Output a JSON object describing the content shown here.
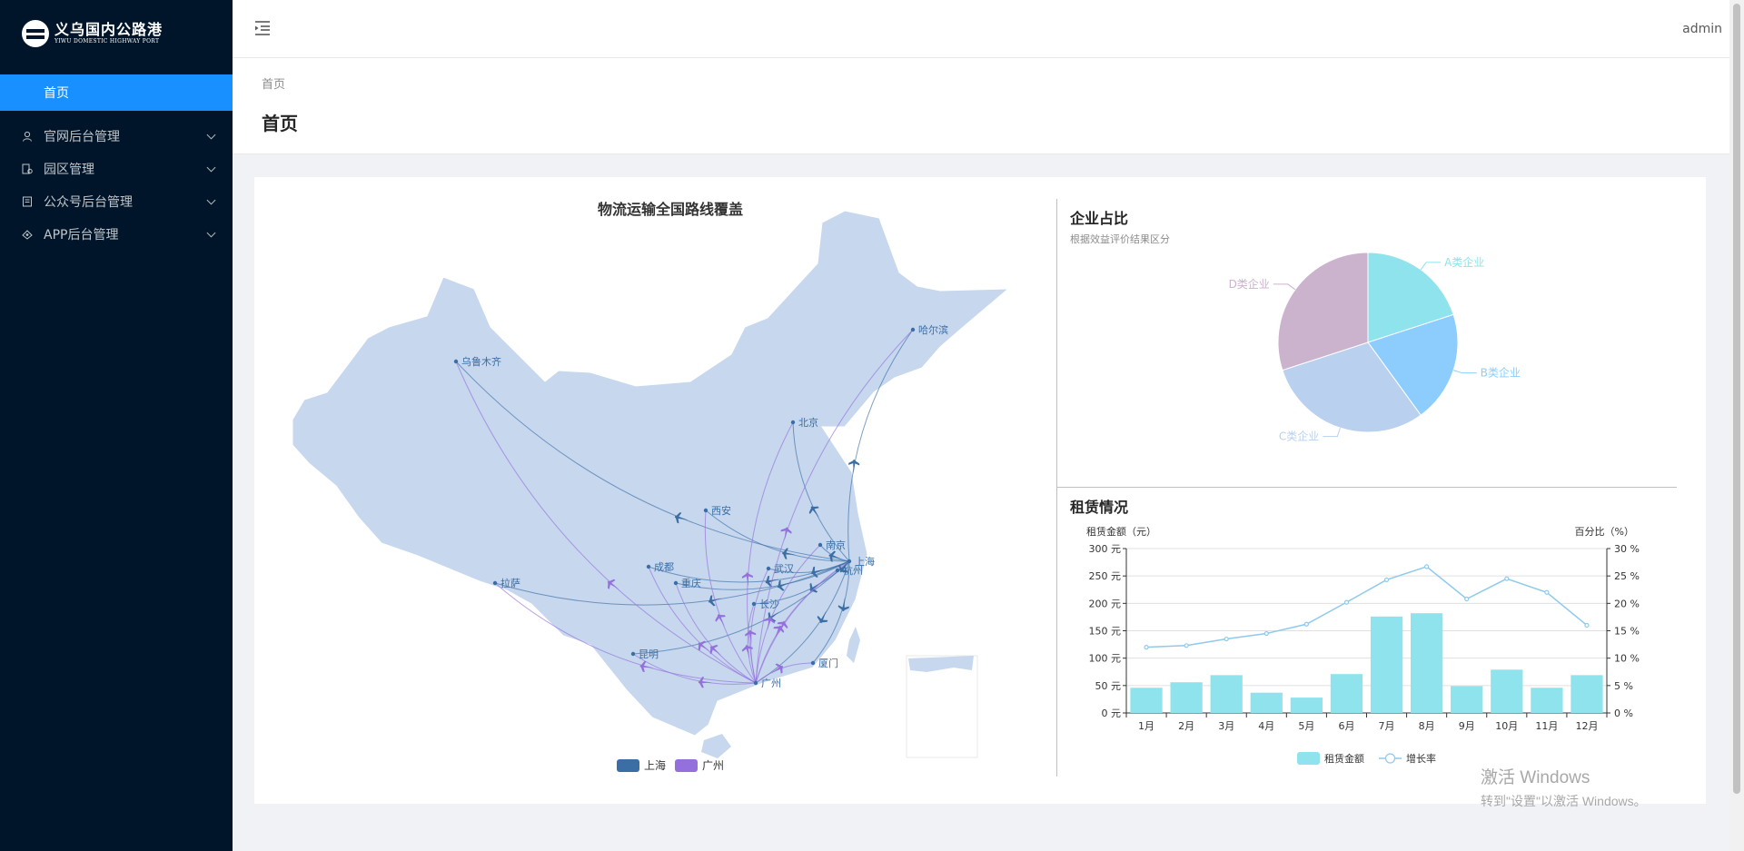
{
  "app": {
    "logo_cn": "义乌国内公路港",
    "logo_en": "YIWU DOMESTIC HIGHWAY PORT"
  },
  "sidebar": {
    "items": [
      {
        "label": "首页",
        "icon": "home-icon"
      },
      {
        "label": "官网后台管理",
        "icon": "user-icon"
      },
      {
        "label": "园区管理",
        "icon": "park-icon"
      },
      {
        "label": "公众号后台管理",
        "icon": "article-icon"
      },
      {
        "label": "APP后台管理",
        "icon": "app-icon"
      }
    ]
  },
  "header": {
    "user": "admin"
  },
  "breadcrumb": "首页",
  "page_title": "首页",
  "map": {
    "title": "物流运输全国路线覆盖",
    "cities": [
      "乌鲁木齐",
      "哈尔滨",
      "北京",
      "西安",
      "南京",
      "上海",
      "杭州",
      "成都",
      "武汉",
      "重庆",
      "长沙",
      "拉萨",
      "昆明",
      "厦门",
      "广州"
    ],
    "legend": [
      {
        "name": "上海",
        "color": "#3a6ea5"
      },
      {
        "name": "广州",
        "color": "#9370db"
      }
    ]
  },
  "chart_data": [
    {
      "type": "pie",
      "title": "企业占比",
      "subtitle": "根据效益评价结果区分",
      "categories": [
        "A类企业",
        "B类企业",
        "C类企业",
        "D类企业"
      ],
      "values": [
        20,
        20,
        30,
        30
      ],
      "colors": [
        "#8fe3ec",
        "#8ccdfd",
        "#bad0ef",
        "#cbb3cd"
      ]
    },
    {
      "type": "bar",
      "title": "租赁情况",
      "categories": [
        "1月",
        "2月",
        "3月",
        "4月",
        "5月",
        "6月",
        "7月",
        "8月",
        "9月",
        "10月",
        "11月",
        "12月"
      ],
      "ylabel": "租赁金额（元）",
      "y2label": "百分比（%）",
      "ylim": [
        0,
        300
      ],
      "y2lim": [
        0,
        30
      ],
      "yticks": [
        "0 元",
        "50 元",
        "100 元",
        "150 元",
        "200 元",
        "250 元",
        "300 元"
      ],
      "y2ticks": [
        "0 %",
        "5 %",
        "10 %",
        "15 %",
        "20 %",
        "25 %",
        "30 %"
      ],
      "series": [
        {
          "name": "租赁金额",
          "type": "bar",
          "color": "#8fe3ec",
          "values": [
            46,
            56,
            69,
            37,
            28,
            71,
            176,
            182,
            49,
            79,
            46,
            69
          ]
        },
        {
          "name": "增长率",
          "type": "line",
          "color": "#8fc9ec",
          "values": [
            12,
            12.3,
            13.5,
            14.5,
            16.2,
            20.2,
            24.3,
            26.7,
            20.8,
            24.5,
            22,
            16
          ]
        }
      ]
    }
  ],
  "watermark": {
    "line1": "激活 Windows",
    "line2": "转到\"设置\"以激活 Windows。"
  }
}
